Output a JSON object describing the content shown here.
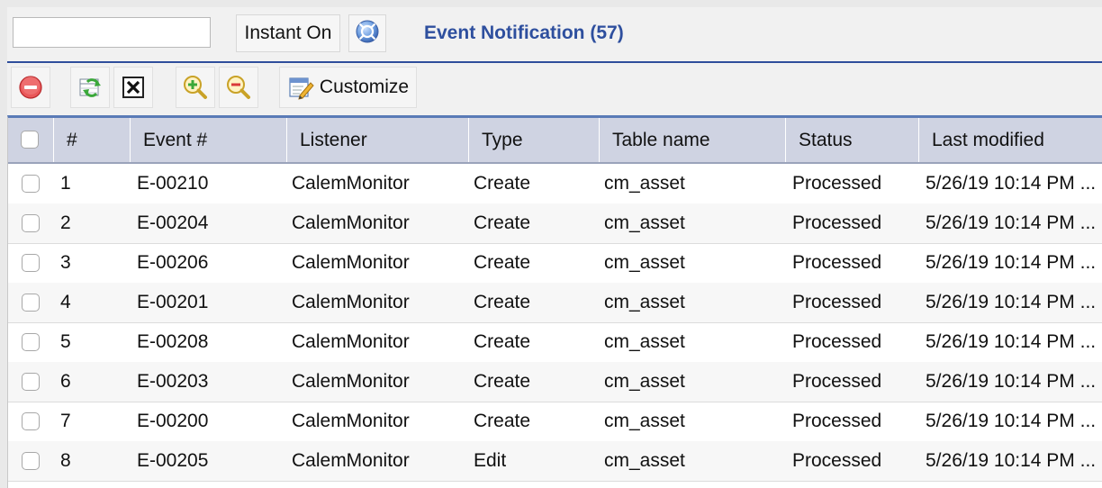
{
  "header": {
    "search_value": "",
    "instant_on_label": "Instant On",
    "title": "Event Notification (57)"
  },
  "toolbar": {
    "customize_label": "Customize"
  },
  "table": {
    "columns": [
      "#",
      "Event #",
      "Listener",
      "Type",
      "Table name",
      "Status",
      "Last modified"
    ],
    "rows": [
      {
        "num": "1",
        "event": "E-00210",
        "listener": "CalemMonitor",
        "type": "Create",
        "table": "cm_asset",
        "status": "Processed",
        "modified": "5/26/19 10:14 PM ..."
      },
      {
        "num": "2",
        "event": "E-00204",
        "listener": "CalemMonitor",
        "type": "Create",
        "table": "cm_asset",
        "status": "Processed",
        "modified": "5/26/19 10:14 PM ..."
      },
      {
        "num": "3",
        "event": "E-00206",
        "listener": "CalemMonitor",
        "type": "Create",
        "table": "cm_asset",
        "status": "Processed",
        "modified": "5/26/19 10:14 PM ..."
      },
      {
        "num": "4",
        "event": "E-00201",
        "listener": "CalemMonitor",
        "type": "Create",
        "table": "cm_asset",
        "status": "Processed",
        "modified": "5/26/19 10:14 PM ..."
      },
      {
        "num": "5",
        "event": "E-00208",
        "listener": "CalemMonitor",
        "type": "Create",
        "table": "cm_asset",
        "status": "Processed",
        "modified": "5/26/19 10:14 PM ..."
      },
      {
        "num": "6",
        "event": "E-00203",
        "listener": "CalemMonitor",
        "type": "Create",
        "table": "cm_asset",
        "status": "Processed",
        "modified": "5/26/19 10:14 PM ..."
      },
      {
        "num": "7",
        "event": "E-00200",
        "listener": "CalemMonitor",
        "type": "Create",
        "table": "cm_asset",
        "status": "Processed",
        "modified": "5/26/19 10:14 PM ..."
      },
      {
        "num": "8",
        "event": "E-00205",
        "listener": "CalemMonitor",
        "type": "Edit",
        "table": "cm_asset",
        "status": "Processed",
        "modified": "5/26/19 10:14 PM ..."
      }
    ]
  }
}
